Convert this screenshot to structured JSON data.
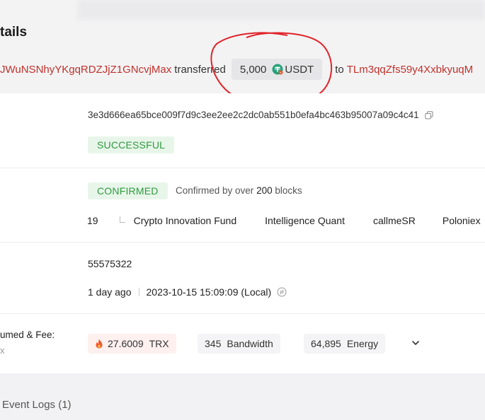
{
  "page": {
    "title": "tails"
  },
  "transfer": {
    "from_address": "JWuNSNhyYKgqRDZJjZ1GNcvjMax",
    "verb": "transferred",
    "amount": "5,000",
    "token": "USDT",
    "to_word": "to",
    "to_address": "TLm3qqZfs59y4XxbkyuqM"
  },
  "details": {
    "hash": "3e3d666ea65bce009f7d9c3ee2ee2c2dc0ab551b0efa4bc463b95007a09c4c41",
    "result": "SUCCESSFUL",
    "confirm_status": "CONFIRMED",
    "confirm_prefix": "Confirmed by over",
    "confirm_count": "200",
    "confirm_suffix": "blocks",
    "confirm_votes": "19",
    "producers": [
      "Crypto Innovation Fund",
      "Intelligence Quant",
      "callmeSR",
      "Poloniex"
    ],
    "block": "55575322",
    "age": "1 day ago",
    "timestamp": "2023-10-15 15:09:09 (Local)"
  },
  "fee": {
    "label": "umed & Fee:",
    "sub": "x",
    "trx_value": "27.6009",
    "trx_unit": "TRX",
    "bandwidth_value": "345",
    "bandwidth_unit": "Bandwidth",
    "energy_value": "64,895",
    "energy_unit": "Energy"
  },
  "event_logs": "Event Logs (1)",
  "colors": {
    "address": "#c0312a",
    "success": "#2e9b3e",
    "usdt": "#26a17b",
    "annotation": "#e0242a"
  }
}
